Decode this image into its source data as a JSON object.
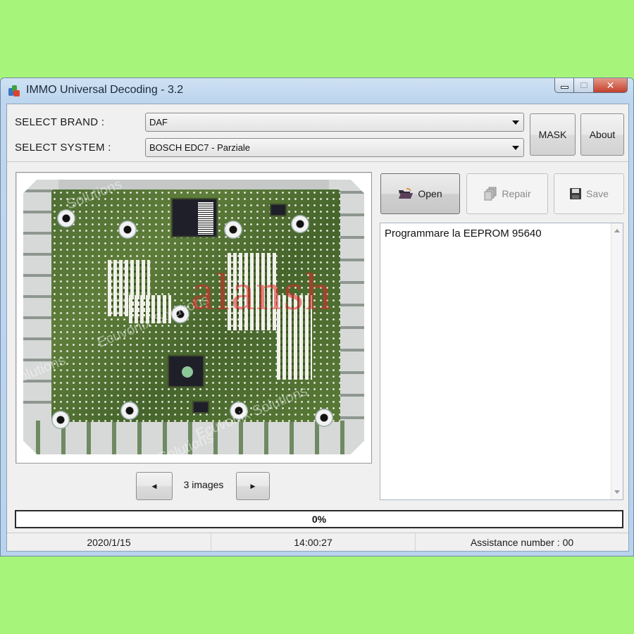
{
  "window": {
    "title": "IMMO Universal Decoding - 3.2",
    "icon": "app-logo-icon",
    "controls": {
      "minimize": "minimize-icon",
      "maximize": "maximize-icon",
      "close": "✕"
    }
  },
  "selectors": {
    "brand_label": "SELECT BRAND :",
    "brand_value": "DAF",
    "system_label": "SELECT SYSTEM :",
    "system_value": "BOSCH EDC7 - Parziale"
  },
  "top_buttons": {
    "mask_label": "MASK",
    "about_label": "About"
  },
  "actions": {
    "open_label": "Open",
    "open_icon": "folder-open-icon",
    "repair_label": "Repair",
    "repair_icon": "repair-pages-icon",
    "repair_enabled": false,
    "save_label": "Save",
    "save_icon": "floppy-disk-icon",
    "save_enabled": false
  },
  "image_viewer": {
    "description": "ECU circuit board photo",
    "watermark_red": "alansh",
    "watermark_white": [
      "Solutions",
      "Ecuvonix Solutions",
      "Solutions",
      "Ecuvonix Solutions",
      "Solutions"
    ],
    "count_label": "3 images",
    "prev_icon": "◀",
    "next_icon": "▶"
  },
  "log": {
    "text": "Programmare la EEPROM 95640"
  },
  "progress": {
    "value_percent": 0,
    "label": "0%"
  },
  "status_bar": {
    "date": "2020/1/15",
    "time": "14:00:27",
    "assistance": "Assistance number : 00"
  },
  "colors": {
    "page_background": "#a6f57a",
    "window_frame": "#bed6ee",
    "close_button": "#c4402b",
    "watermark_red": "#dc2828"
  }
}
